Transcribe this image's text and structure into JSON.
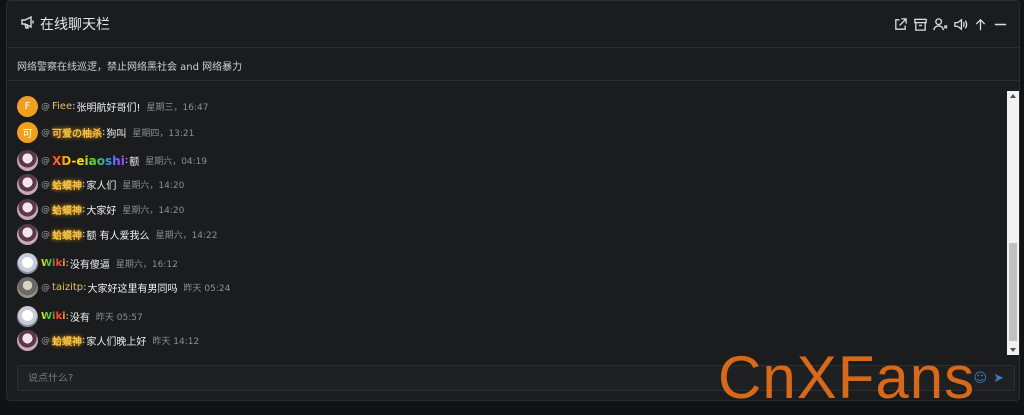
{
  "header": {
    "title": "在线聊天栏",
    "icons": [
      "megaphone-icon",
      "external-link-icon",
      "archive-icon",
      "user-block-icon",
      "volume-icon",
      "pin-icon",
      "minimize-icon"
    ]
  },
  "notice": "网络警察在线巡逻，禁止网络黑社会 and 网络暴力",
  "messages": [
    {
      "avatar_text": "F",
      "at": "@",
      "name": "Fiee",
      "text": "张明航好哥们!",
      "time": "星期三，16:47"
    },
    {
      "avatar_text": "可",
      "at": "@",
      "name": "可爱の柚杀",
      "text": "狗叫",
      "time": "星期四，13:21"
    },
    {
      "avatar_text": "",
      "at": "@",
      "name": "XD-eiaoshi",
      "text": "额",
      "time": "星期六，04:19"
    },
    {
      "avatar_text": "",
      "at": "@",
      "name": "蛤蟆神",
      "text": "家人们",
      "time": "星期六，14:20"
    },
    {
      "avatar_text": "",
      "at": "@",
      "name": "蛤蟆神",
      "text": "大家好",
      "time": "星期六，14:20"
    },
    {
      "avatar_text": "",
      "at": "@",
      "name": "蛤蟆神",
      "text": "额 有人爱我么",
      "time": "星期六，14:22"
    },
    {
      "avatar_text": "",
      "at": "",
      "name": "Wiki",
      "text": "没有傻逼",
      "time": "星期六，16:12"
    },
    {
      "avatar_text": "",
      "at": "@",
      "name": "taizitp",
      "text": "大家好这里有男同吗",
      "time": "昨天 05:24"
    },
    {
      "avatar_text": "",
      "at": "",
      "name": "Wiki",
      "text": "没有",
      "time": "昨天 05:57"
    },
    {
      "avatar_text": "",
      "at": "@",
      "name": "蛤蟆神",
      "text": "家人们晚上好",
      "time": "昨天 14:12"
    }
  ],
  "input": {
    "placeholder": "说点什么?"
  },
  "watermark": "CnXFans",
  "colors": {
    "background": "#1b1c1e",
    "accent_gold": "#f3c24a",
    "watermark": "#e8701a"
  }
}
